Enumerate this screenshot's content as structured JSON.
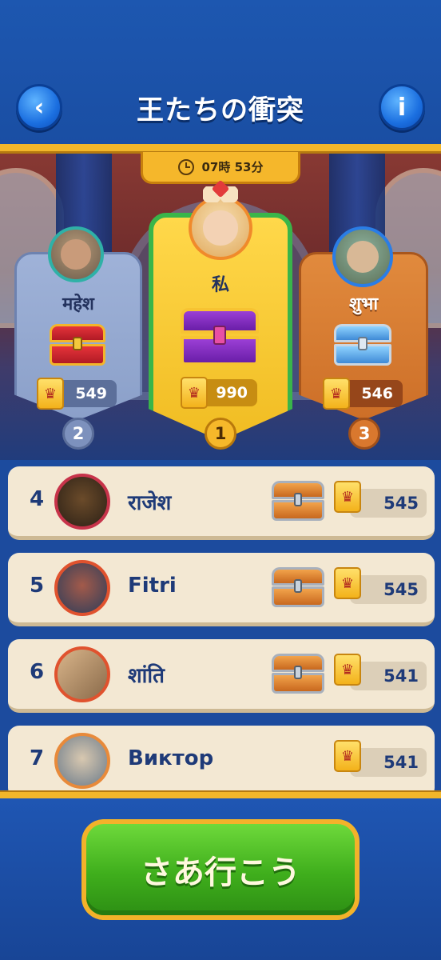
{
  "header": {
    "title": "王たちの衝突",
    "back_icon": "‹",
    "info_icon": "i"
  },
  "timer": {
    "text": "07時 53分"
  },
  "podium": {
    "first": {
      "name": "私",
      "score": "990",
      "rank": "1"
    },
    "second": {
      "name": "महेश",
      "score": "549",
      "rank": "2"
    },
    "third": {
      "name": "शुभा",
      "score": "546",
      "rank": "3"
    }
  },
  "list": [
    {
      "rank": "4",
      "name": "राजेश",
      "score": "545"
    },
    {
      "rank": "5",
      "name": "Fitri",
      "score": "545"
    },
    {
      "rank": "6",
      "name": "शांति",
      "score": "541"
    },
    {
      "rank": "7",
      "name": "Виктор",
      "score": "541"
    }
  ],
  "footer": {
    "go_label": "さあ行こう"
  },
  "colors": {
    "header_blue": "#1d57b0",
    "gold": "#f2b62a",
    "winner_border": "#39b54a",
    "go_green": "#3fae1c"
  },
  "icons": {
    "back": "chevron-left-icon",
    "info": "info-icon",
    "clock": "clock-icon",
    "crown": "crown-card-icon",
    "chest": "treasure-chest-icon"
  }
}
